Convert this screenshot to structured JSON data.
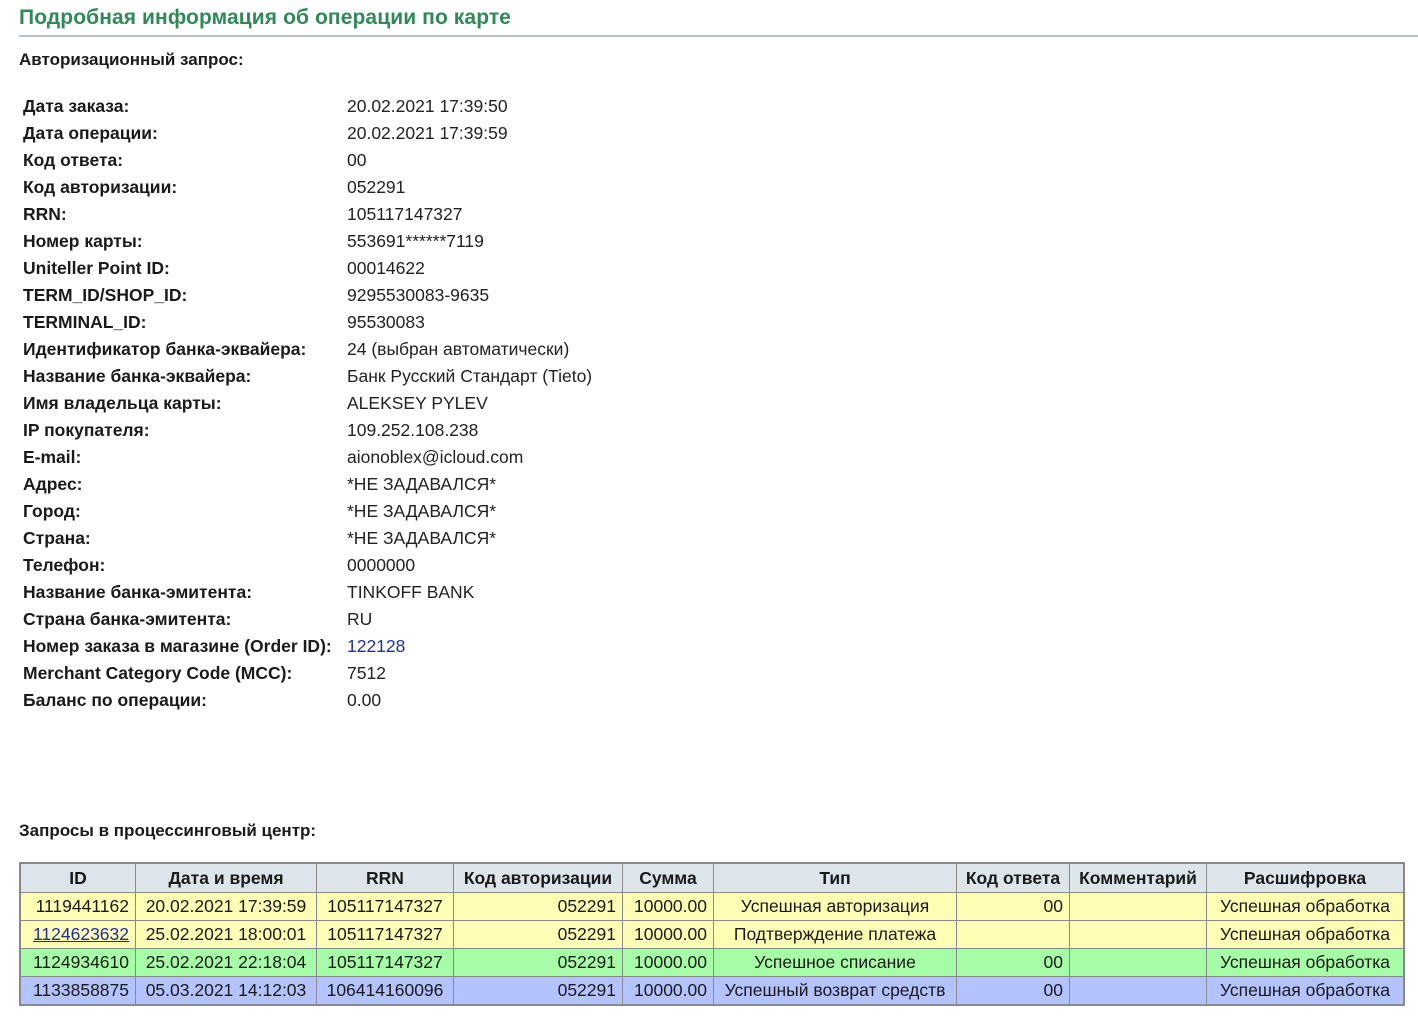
{
  "page_title": "Подробная информация об операции по карте",
  "auth_section": {
    "heading": "Авторизационный запрос:",
    "rows": [
      {
        "label": "Дата заказа:",
        "value": "20.02.2021 17:39:50"
      },
      {
        "label": "Дата операции:",
        "value": "20.02.2021 17:39:59"
      },
      {
        "label": "Код ответа:",
        "value": "00"
      },
      {
        "label": "Код авторизации:",
        "value": "052291"
      },
      {
        "label": "RRN:",
        "value": "105117147327"
      },
      {
        "label": "Номер карты:",
        "value": "553691******7119"
      },
      {
        "label": "Uniteller Point ID:",
        "value": "00014622"
      },
      {
        "label": "TERM_ID/SHOP_ID:",
        "value": "9295530083-9635"
      },
      {
        "label": "TERMINAL_ID:",
        "value": "95530083"
      },
      {
        "label": "Идентификатор банка-эквайера:",
        "value": "24 (выбран автоматически)"
      },
      {
        "label": "Название банка-эквайера:",
        "value": "Банк Русский Стандарт (Tieto)"
      },
      {
        "label": "Имя владельца карты:",
        "value": "ALEKSEY PYLEV"
      },
      {
        "label": "IP покупателя:",
        "value": "109.252.108.238"
      },
      {
        "label": "E-mail:",
        "value": "aionoblex@icloud.com"
      },
      {
        "label": "Адрес:",
        "value": "*НЕ ЗАДАВАЛСЯ*"
      },
      {
        "label": "Город:",
        "value": "*НЕ ЗАДАВАЛСЯ*"
      },
      {
        "label": "Страна:",
        "value": "*НЕ ЗАДАВАЛСЯ*"
      },
      {
        "label": "Телефон:",
        "value": "0000000"
      },
      {
        "label": "Название банка-эмитента:",
        "value": "TINKOFF BANK"
      },
      {
        "label": "Страна банка-эмитента:",
        "value": "RU"
      },
      {
        "label": "Номер заказа в магазине (Order ID):",
        "value": "122128",
        "link": true
      },
      {
        "label": "Merchant Category Code (MCC):",
        "value": "7512"
      },
      {
        "label": "Баланс по операции:",
        "value": "0.00"
      }
    ]
  },
  "processing_section": {
    "heading": "Запросы в процессинговый центр:",
    "columns": [
      "ID",
      "Дата и время",
      "RRN",
      "Код авторизации",
      "Сумма",
      "Тип",
      "Код ответа",
      "Комментарий",
      "Расшифровка"
    ],
    "row_colors": {
      "yellow": "#fdfdb4",
      "green": "#a7fca7",
      "blue": "#b3c3ff"
    },
    "rows": [
      {
        "color": "yellow",
        "id": "1119441162",
        "id_link": false,
        "datetime": "20.02.2021 17:39:59",
        "rrn": "105117147327",
        "auth_code": "052291",
        "amount": "10000.00",
        "type": "Успешная авторизация",
        "resp_code": "00",
        "comment": "",
        "decoding": "Успешная обработка"
      },
      {
        "color": "yellow",
        "id": "1124623632",
        "id_link": true,
        "datetime": "25.02.2021 18:00:01",
        "rrn": "105117147327",
        "auth_code": "052291",
        "amount": "10000.00",
        "type": "Подтверждение платежа",
        "resp_code": "",
        "comment": "",
        "decoding": "Успешная обработка"
      },
      {
        "color": "green",
        "id": "1124934610",
        "id_link": false,
        "datetime": "25.02.2021 22:18:04",
        "rrn": "105117147327",
        "auth_code": "052291",
        "amount": "10000.00",
        "type": "Успешное списание",
        "resp_code": "00",
        "comment": "",
        "decoding": "Успешная обработка"
      },
      {
        "color": "blue",
        "id": "1133858875",
        "id_link": false,
        "datetime": "05.03.2021 14:12:03",
        "rrn": "106414160096",
        "auth_code": "052291",
        "amount": "10000.00",
        "type": "Успешный возврат средств",
        "resp_code": "00",
        "comment": "",
        "decoding": "Успешная обработка"
      }
    ]
  }
}
